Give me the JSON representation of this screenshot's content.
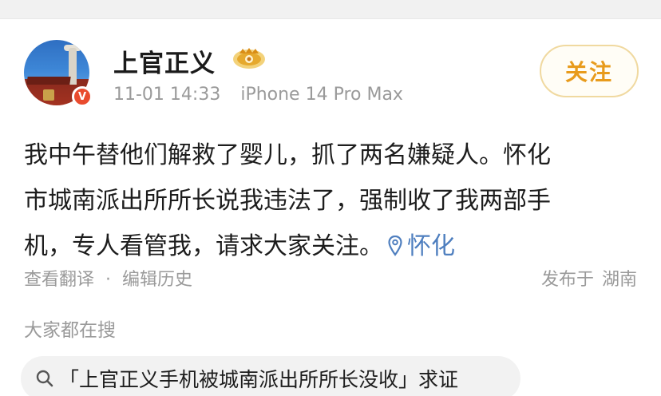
{
  "post": {
    "username": "上官正义",
    "timestamp": "11-01 14:33",
    "device": "iPhone 14 Pro Max",
    "follow_label": "关注",
    "verified_badge": "V",
    "lines": [
      "我中午替他们解救了婴儿，抓了两名嫌疑人。怀化",
      "市城南派出所所长说我违法了，强制收了我两部手",
      "机，专人看管我，请求大家关注。"
    ],
    "location": "怀化",
    "actions": {
      "translate": "查看翻译",
      "separator": "·",
      "edit_history": "编辑历史"
    },
    "published": {
      "label": "发布于",
      "place": "湖南"
    }
  },
  "related": {
    "title": "大家都在搜",
    "query": "「上官正义手机被城南派出所所长没收」求证"
  },
  "colors": {
    "accent_follow": "#e89b1c",
    "location_link": "#4f7fbf",
    "meta_gray": "#9a9a9a",
    "verified_red": "#e94b2e"
  },
  "icons": [
    "vip-crown-icon",
    "verified-v-icon",
    "location-pin-icon",
    "search-icon"
  ]
}
